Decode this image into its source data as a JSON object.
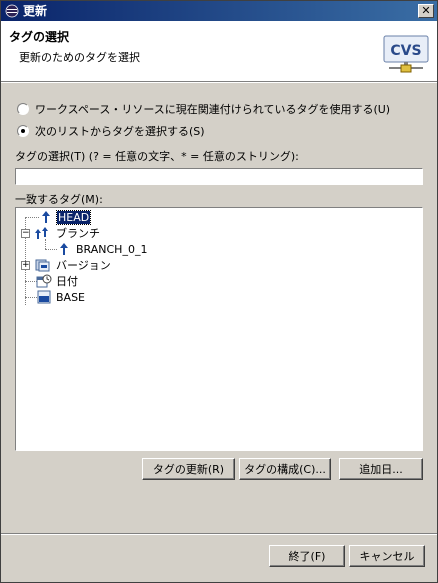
{
  "window": {
    "title": "更新"
  },
  "header": {
    "title": "タグの選択",
    "description": "更新のためのタグを選択"
  },
  "options": {
    "radio_current": "ワークスペース・リソースに現在関連付けられているタグを使用する(U)",
    "radio_list": "次のリストからタグを選択する(S)",
    "radio_selected": "list"
  },
  "filter": {
    "label": "タグの選択(T) (? = 任意の文字、* = 任意のストリング):",
    "value": ""
  },
  "matching": {
    "label": "一致するタグ(M):"
  },
  "tree": {
    "head": "HEAD",
    "branches": "ブランチ",
    "branch_item": "BRANCH_0_1",
    "versions": "バージョン",
    "dates": "日付",
    "base": "BASE"
  },
  "buttons": {
    "refresh": "タグの更新(R)",
    "configure": "タグの構成(C)...",
    "add_date": "追加日...",
    "finish": "終了(F)",
    "cancel": "キャンセル"
  }
}
